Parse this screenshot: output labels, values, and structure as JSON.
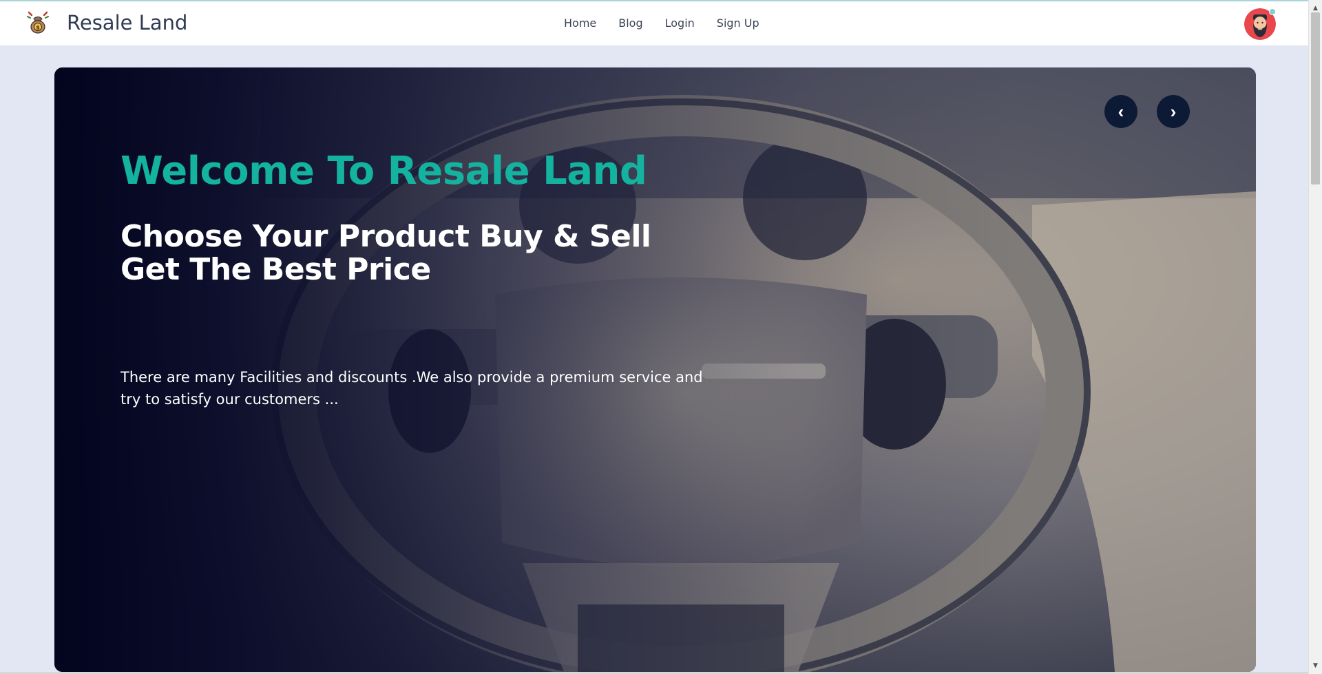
{
  "brand": {
    "name": "Resale Land",
    "logo_icon": "money-bag-icon"
  },
  "nav": {
    "links": [
      {
        "label": "Home"
      },
      {
        "label": "Blog"
      },
      {
        "label": "Login"
      },
      {
        "label": "Sign Up"
      }
    ]
  },
  "user": {
    "avatar_icon": "bearded-man-avatar",
    "status_color": "#7fd0cf"
  },
  "hero": {
    "title": "Welcome To Resale Land",
    "subtitle_line1": "Choose Your Product Buy & Sell",
    "subtitle_line2": "Get The Best Price",
    "description_line1": "There are many Facilities and discounts .We also provide a premium service and",
    "description_line2": "try to satisfy our customers ...",
    "background_image": "car-steering-wheel-interior",
    "prev_label": "‹",
    "next_label": "›"
  },
  "colors": {
    "accent": "#14b3a0",
    "page_bg": "#e2e7f3",
    "nav_text": "#3b4558",
    "button_bg": "#0c1a36"
  }
}
